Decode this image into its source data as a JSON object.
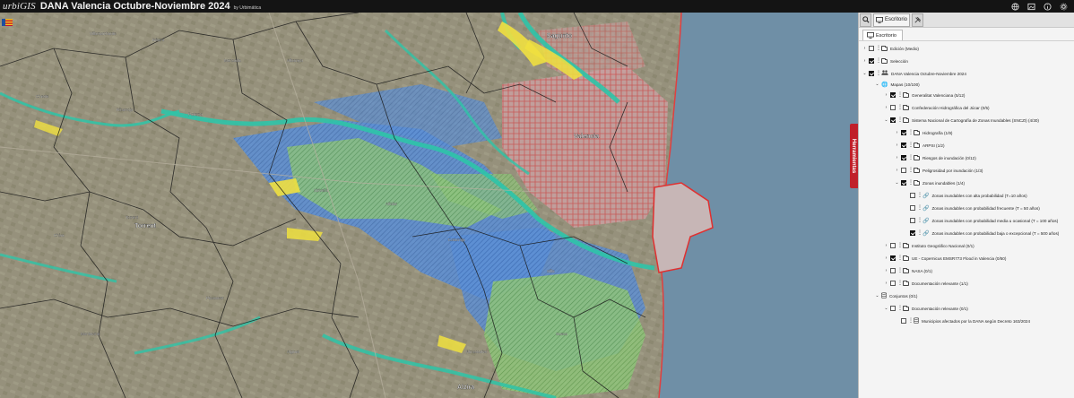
{
  "app": {
    "logo": "urbiGIS",
    "title": "DANA Valencia Octubre-Noviembre 2024",
    "byline": "by Urbimática"
  },
  "top_icons": [
    "globe-icon",
    "image-icon",
    "info-icon",
    "settings-icon"
  ],
  "panel": {
    "tabs": [
      {
        "name": "search-icon"
      },
      {
        "label": "Escritorio"
      },
      {
        "name": "tools-icon"
      }
    ],
    "subtab": "Escritorio",
    "side_tab": "Herramientas"
  },
  "map_labels": [
    "Valencia",
    "Sagunto",
    "Torrent",
    "Alzira"
  ],
  "tree": [
    {
      "id": "edicion",
      "label": "Edición (Medio)",
      "lvl": 0,
      "chev": ">",
      "cb": "off",
      "icon": "folder"
    },
    {
      "id": "seleccion",
      "label": "Selección",
      "lvl": 0,
      "chev": ">",
      "cb": "on",
      "icon": "folder"
    },
    {
      "id": "dana",
      "label": "DANA Valencia Octubre-Noviembre 2024",
      "lvl": 0,
      "chev": "v",
      "cb": "on",
      "icon": "group"
    },
    {
      "id": "mapas",
      "label": "Mapas (10/100)",
      "lvl": 1,
      "chev": "v",
      "cb": "none",
      "icon": "globe"
    },
    {
      "id": "gva",
      "label": "Generalitat Valenciana (5/12)",
      "lvl": 2,
      "chev": ">",
      "cb": "on",
      "icon": "folder"
    },
    {
      "id": "chj",
      "label": "Confederación Hidrográfica del Júcar (0/5)",
      "lvl": 2,
      "chev": ">",
      "cb": "off",
      "icon": "folder"
    },
    {
      "id": "snczi",
      "label": "Sistema Nacional de Cartografía de Zonas Inundables (SNCZI) (4/30)",
      "lvl": 2,
      "chev": "v",
      "cb": "on",
      "icon": "folder"
    },
    {
      "id": "hidro",
      "label": "Hidrografía (1/9)",
      "lvl": 3,
      "chev": ">",
      "cb": "on",
      "icon": "folder"
    },
    {
      "id": "arpsi",
      "label": "ARPSI (1/2)",
      "lvl": 3,
      "chev": ">",
      "cb": "on",
      "icon": "folder"
    },
    {
      "id": "riesgo",
      "label": "Riesgos de inundación (0/12)",
      "lvl": 3,
      "chev": ">",
      "cb": "on",
      "icon": "folder"
    },
    {
      "id": "peli",
      "label": "Peligrosidad por inundación (1/3)",
      "lvl": 3,
      "chev": ">",
      "cb": "off",
      "icon": "folder"
    },
    {
      "id": "zonas",
      "label": "Zonas inundables (1/4)",
      "lvl": 3,
      "chev": "v",
      "cb": "on",
      "icon": "folder"
    },
    {
      "id": "z10",
      "label": "Zonas inundables con alta probabilidad (T=10 años)",
      "lvl": 4,
      "chev": "",
      "cb": "off",
      "icon": "link"
    },
    {
      "id": "z50",
      "label": "Zonas inundables con probabilidad frecuente (T = 50 años)",
      "lvl": 4,
      "chev": "",
      "cb": "off",
      "icon": "link"
    },
    {
      "id": "z100",
      "label": "Zonas inundables con probabilidad media u ocasional (T = 100 años)",
      "lvl": 4,
      "chev": "",
      "cb": "off",
      "icon": "link"
    },
    {
      "id": "z500",
      "label": "Zonas inundables con probabilidad baja o excepcional (T = 500 años)",
      "lvl": 4,
      "chev": "",
      "cb": "on",
      "icon": "link"
    },
    {
      "id": "ign",
      "label": "Instituto Geográfico Nacional (0/1)",
      "lvl": 2,
      "chev": ">",
      "cb": "off",
      "icon": "folder"
    },
    {
      "id": "ems",
      "label": "UE - Copernicus EMSR773 Flood in Valencia (0/50)",
      "lvl": 2,
      "chev": ">",
      "cb": "on",
      "icon": "folder"
    },
    {
      "id": "nasa",
      "label": "NASA (0/1)",
      "lvl": 2,
      "chev": ">",
      "cb": "off",
      "icon": "folder"
    },
    {
      "id": "docrel",
      "label": "Documentación relevante (1/1)",
      "lvl": 2,
      "chev": ">",
      "cb": "off",
      "icon": "folder"
    },
    {
      "id": "conj",
      "label": "Conjuntos (0/1)",
      "lvl": 1,
      "chev": "v",
      "cb": "none",
      "icon": "db"
    },
    {
      "id": "docrel2",
      "label": "Documentación relevante (0/1)",
      "lvl": 2,
      "chev": "v",
      "cb": "off",
      "icon": "folder"
    },
    {
      "id": "muni",
      "label": "Municipios afectados por la DANA según Decreto 163/2024",
      "lvl": 3,
      "chev": "",
      "cb": "off",
      "icon": "db"
    }
  ]
}
